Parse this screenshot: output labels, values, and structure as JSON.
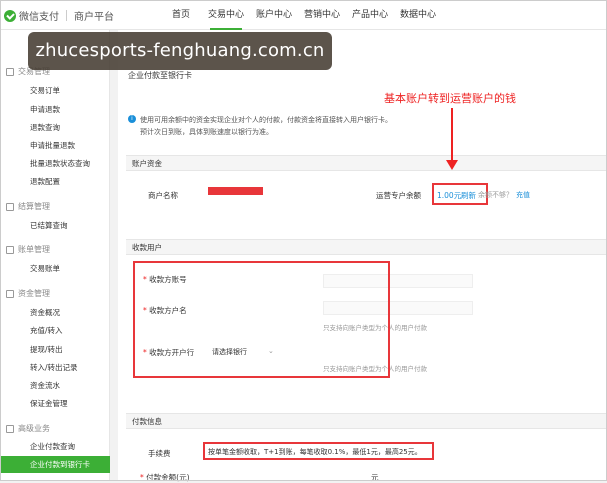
{
  "header": {
    "brand": "微信支付",
    "subbrand": "商户平台",
    "nav": [
      "首页",
      "交易中心",
      "账户中心",
      "营销中心",
      "产品中心",
      "数据中心"
    ],
    "active_nav": "交易中心"
  },
  "watermark": "zhucesports-fenghuang.com.cn",
  "sidebar": {
    "groups": [
      {
        "title": "交易管理",
        "items": [
          "交易订单",
          "申请退款",
          "退款查询",
          "申请批量退款",
          "批量退款状态查询",
          "退款配置"
        ]
      },
      {
        "title": "结算管理",
        "items": [
          "已结算查询"
        ]
      },
      {
        "title": "账单管理",
        "items": [
          "交易账单"
        ]
      },
      {
        "title": "资金管理",
        "items": [
          "资金概况",
          "充值/转入",
          "提现/转出",
          "转入/转出记录",
          "资金流水",
          "保证金管理"
        ]
      },
      {
        "title": "高级业务",
        "items": [
          "企业付款查询"
        ]
      }
    ],
    "active_item": "企业付款到银行卡"
  },
  "main": {
    "breadcrumb": "企业付款至银行卡",
    "info_line1": "使用可用余额中的资金实现企业对个人的付款，付款资金将直接转入用户银行卡。",
    "info_line2": "预计次日到账，具体到账速度以银行为准。",
    "section_account": "账户资金",
    "merchant_name_label": "商户名称",
    "balance_label": "运营专户余额",
    "balance_value": "1.00元",
    "balance_link": "刷新",
    "balance_insufficient": "余额不够？",
    "recharge_link": "充值",
    "annotation": "基本账户转到运营账户的钱",
    "section_payee": "收款用户",
    "payee_account_label": "收款方账号",
    "payee_name_label": "收款方户名",
    "payee_name_hint": "只支持向账户类型为个人的用户付款",
    "payee_bank_label": "收款方开户行",
    "payee_bank_placeholder": "请选择银行",
    "payee_bank_hint": "只支持向账户类型为个人的用户付款",
    "section_payment": "付款信息",
    "fee_label": "手续费",
    "fee_text": "按单笔金额收取，T+1到账，每笔收取0.1%，最低1元，最高25元。",
    "amount_label": "付款金额(元)",
    "amount_unit": "元",
    "required_mark": "*"
  },
  "colors": {
    "accent": "#3caf36",
    "highlight": "#e8363a",
    "link": "#1a8fd9"
  }
}
